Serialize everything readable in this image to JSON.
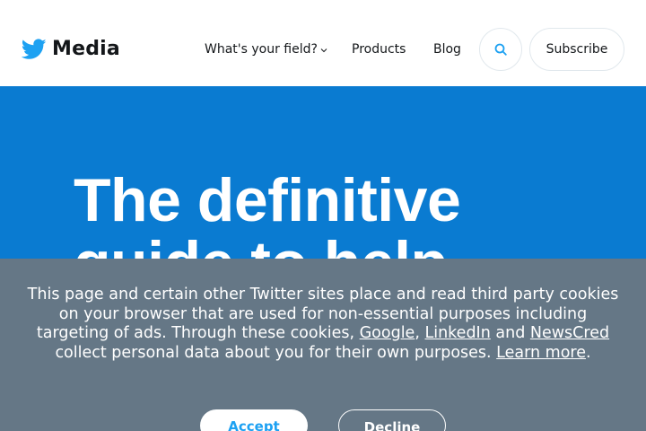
{
  "colors": {
    "brand": "#1da1f2",
    "hero_bg": "#0a7bd1",
    "cookie_bg": "#657786",
    "text_dark": "#14171a"
  },
  "header": {
    "logo_icon": "twitter-bird-icon",
    "logo_text": "Media",
    "nav": {
      "field": "What's your field?",
      "products": "Products",
      "blog": "Blog"
    },
    "search_icon": "search-icon",
    "subscribe_label": "Subscribe"
  },
  "hero": {
    "title": "The definitive guide to help"
  },
  "cookie_banner": {
    "text_1": "This page and certain other Twitter sites place and read third party cookies on your browser that are used for non-essential purposes including targeting of ads. Through these cookies, ",
    "link_google": "Google",
    "sep_1": ", ",
    "link_linkedin": "LinkedIn",
    "sep_2": " and ",
    "link_newscred": "NewsCred",
    "text_2": " collect personal data about you for their own purposes. ",
    "link_learn_more": "Learn more",
    "text_3": ".",
    "accept_label": "Accept",
    "decline_label": "Decline"
  }
}
